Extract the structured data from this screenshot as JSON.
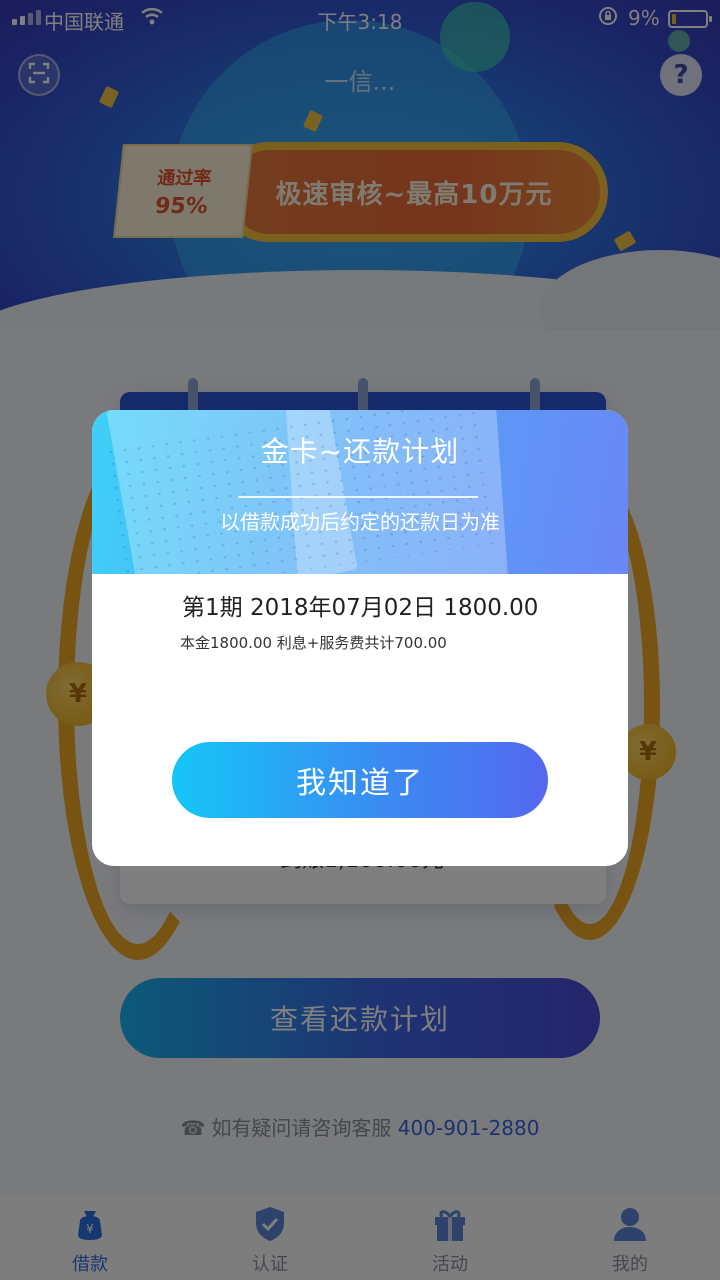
{
  "status_bar": {
    "carrier": "中国联通",
    "time": "下午3:18",
    "battery_percent": "9%",
    "battery_level": 0.09
  },
  "header": {
    "title": "一信...",
    "scan_icon": "scan-icon",
    "help_icon": "help-icon"
  },
  "banner": {
    "tag_line1": "通过率",
    "tag_line2": "95%",
    "text": "极速审核~最高10万元"
  },
  "main": {
    "amount_text": "到账1,100.00元",
    "view_plan_button": "查看还款计划",
    "hotline_prefix": "如有疑问请咨询客服",
    "hotline_number": "400-901-2880"
  },
  "tabbar": {
    "items": [
      {
        "label": "借款",
        "icon": "loan-bag-icon",
        "active": true
      },
      {
        "label": "认证",
        "icon": "shield-check-icon",
        "active": false
      },
      {
        "label": "活动",
        "icon": "gift-icon",
        "active": false
      },
      {
        "label": "我的",
        "icon": "user-icon",
        "active": false
      }
    ]
  },
  "modal": {
    "title": "金卡~还款计划",
    "subtitle": "以借款成功后约定的还款日为准",
    "installment": "第1期 2018年07月02日 1800.00",
    "detail": "本金1800.00 利息+服务费共计700.00",
    "ok_button": "我知道了"
  },
  "colors": {
    "accent": "#3a63e0",
    "button_gradient_start": "#14c6f7",
    "button_gradient_end": "#5468f0",
    "banner_orange": "#ea6a3a",
    "banner_gold": "#f6c13d"
  }
}
